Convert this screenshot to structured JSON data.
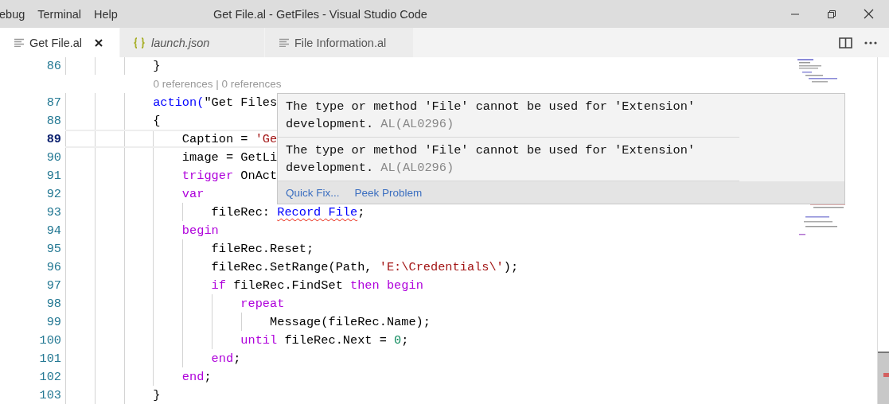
{
  "menu": [
    "ebug",
    "Terminal",
    "Help"
  ],
  "window": {
    "title": "Get File.al - GetFiles - Visual Studio Code"
  },
  "tabs": [
    {
      "label": "Get File.al",
      "selected": true,
      "preview": false,
      "kind": "text"
    },
    {
      "label": "launch.json",
      "selected": false,
      "preview": true,
      "kind": "json"
    },
    {
      "label": "File Information.al",
      "selected": false,
      "preview": false,
      "kind": "text"
    }
  ],
  "lines": [
    {
      "kind": "code",
      "number": "86",
      "current": false,
      "tokens": [
        {
          "kind": "plain",
          "text": "            }"
        }
      ]
    },
    {
      "kind": "codelens",
      "text": "0 references | 0 references"
    },
    {
      "kind": "code",
      "number": "87",
      "current": false,
      "tokens": [
        {
          "kind": "decl",
          "text": "            action("
        },
        {
          "kind": "plain",
          "text": "\"Get Files"
        }
      ]
    },
    {
      "kind": "code",
      "number": "88",
      "current": false,
      "tokens": [
        {
          "kind": "plain",
          "text": "            {"
        }
      ]
    },
    {
      "kind": "code",
      "number": "89",
      "current": true,
      "tokens": [
        {
          "kind": "plain",
          "text": "                Caption = "
        },
        {
          "kind": "string",
          "text": "'Ge"
        }
      ]
    },
    {
      "kind": "code",
      "number": "90",
      "current": false,
      "tokens": [
        {
          "kind": "plain",
          "text": "                image = GetLi"
        }
      ]
    },
    {
      "kind": "code",
      "number": "91",
      "current": false,
      "tokens": [
        {
          "kind": "keyword",
          "text": "                trigger"
        },
        {
          "kind": "plain",
          "text": " OnAct"
        }
      ]
    },
    {
      "kind": "code",
      "number": "92",
      "current": false,
      "tokens": [
        {
          "kind": "keyword",
          "text": "                var"
        }
      ]
    },
    {
      "kind": "code",
      "number": "93",
      "current": false,
      "tokens": [
        {
          "kind": "plain",
          "text": "                    fileRec: "
        },
        {
          "kind": "type",
          "text": "Record File",
          "error": true
        },
        {
          "kind": "plain",
          "text": ";"
        }
      ]
    },
    {
      "kind": "code",
      "number": "94",
      "current": false,
      "tokens": [
        {
          "kind": "keyword",
          "text": "                begin"
        }
      ]
    },
    {
      "kind": "code",
      "number": "95",
      "current": false,
      "tokens": [
        {
          "kind": "plain",
          "text": "                    fileRec.Reset;"
        }
      ]
    },
    {
      "kind": "code",
      "number": "96",
      "current": false,
      "tokens": [
        {
          "kind": "plain",
          "text": "                    fileRec.SetRange(Path, "
        },
        {
          "kind": "string",
          "text": "'E:\\Credentials\\'"
        },
        {
          "kind": "plain",
          "text": ");"
        }
      ]
    },
    {
      "kind": "code",
      "number": "97",
      "current": false,
      "tokens": [
        {
          "kind": "keyword",
          "text": "                    if"
        },
        {
          "kind": "plain",
          "text": " fileRec.FindSet "
        },
        {
          "kind": "keyword",
          "text": "then begin"
        }
      ]
    },
    {
      "kind": "code",
      "number": "98",
      "current": false,
      "tokens": [
        {
          "kind": "keyword",
          "text": "                        repeat"
        }
      ]
    },
    {
      "kind": "code",
      "number": "99",
      "current": false,
      "tokens": [
        {
          "kind": "plain",
          "text": "                            Message(fileRec.Name);"
        }
      ]
    },
    {
      "kind": "code",
      "number": "100",
      "current": false,
      "tokens": [
        {
          "kind": "keyword",
          "text": "                        until"
        },
        {
          "kind": "plain",
          "text": " fileRec.Next = "
        },
        {
          "kind": "number",
          "text": "0"
        },
        {
          "kind": "plain",
          "text": ";"
        }
      ]
    },
    {
      "kind": "code",
      "number": "101",
      "current": false,
      "tokens": [
        {
          "kind": "keyword",
          "text": "                    end"
        },
        {
          "kind": "plain",
          "text": ";"
        }
      ]
    },
    {
      "kind": "code",
      "number": "102",
      "current": false,
      "tokens": [
        {
          "kind": "keyword",
          "text": "                end"
        },
        {
          "kind": "plain",
          "text": ";"
        }
      ]
    },
    {
      "kind": "code",
      "number": "103",
      "current": false,
      "tokens": [
        {
          "kind": "plain",
          "text": "            }"
        }
      ]
    }
  ],
  "hover": {
    "messages": [
      {
        "text": "The type or method 'File' cannot be used for 'Extension' development.",
        "code": "AL(AL0296)"
      },
      {
        "text": "The type or method 'File' cannot be used for 'Extension' development.",
        "code": "AL(AL0296)"
      }
    ],
    "actions": [
      "Quick Fix...",
      "Peek Problem"
    ]
  }
}
